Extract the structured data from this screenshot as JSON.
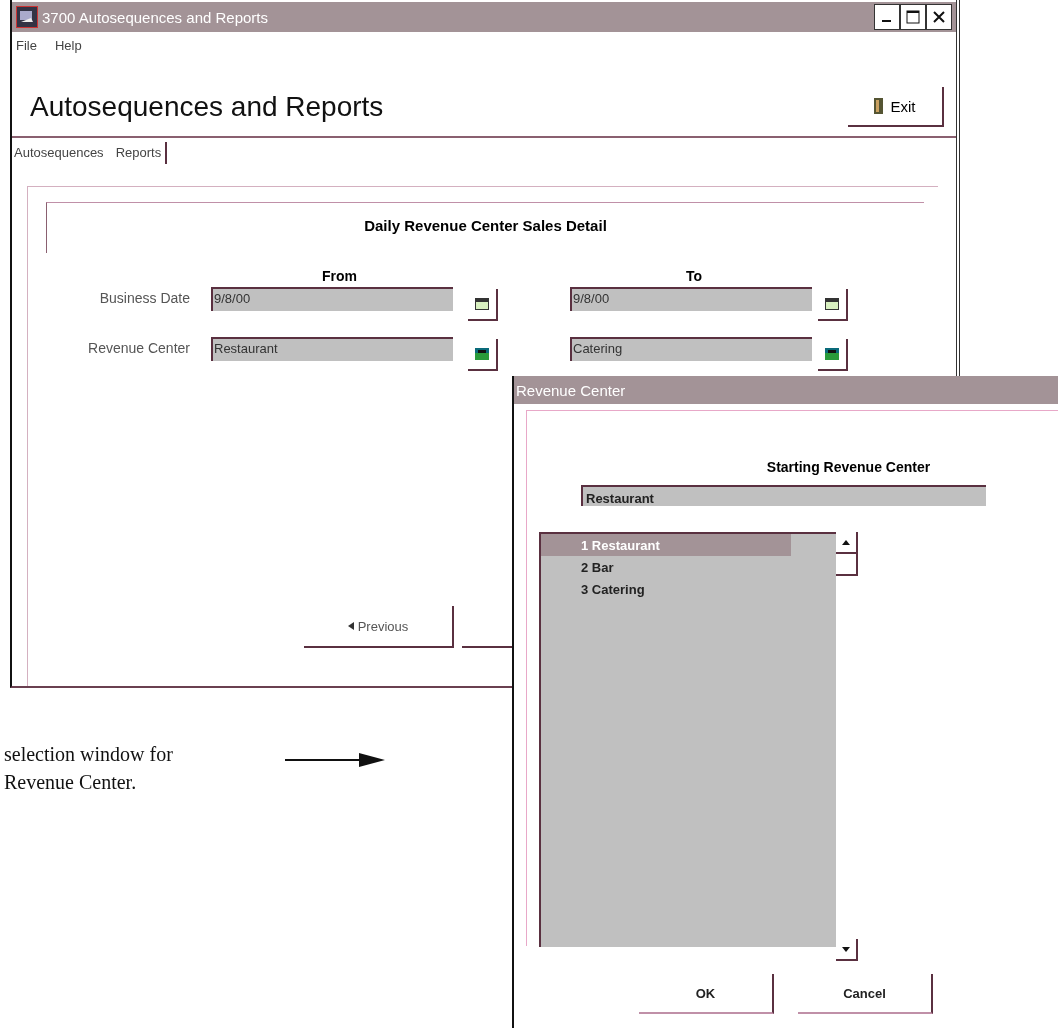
{
  "main_window": {
    "title": "3700 Autosequences and Reports",
    "menu": [
      "File",
      "Help"
    ],
    "heading": "Autosequences and Reports",
    "exit_button": "Exit",
    "tabs": [
      {
        "label": "Autosequences",
        "selected": false
      },
      {
        "label": "Reports",
        "selected": true
      }
    ],
    "report_title": "Daily Revenue Center Sales Detail",
    "columns": [
      "From",
      "To"
    ],
    "rows": [
      {
        "label": "Business Date",
        "kind": "date",
        "from": "9/8/00",
        "to": "9/8/00"
      },
      {
        "label": "Revenue Center",
        "kind": "list",
        "from": "Restaurant",
        "to": "Catering"
      }
    ],
    "previous_button": "Previous"
  },
  "dialog": {
    "title": "Revenue Center",
    "heading": "Starting Revenue Center",
    "value": "Restaurant",
    "items": [
      {
        "label": "1 Restaurant",
        "selected": true
      },
      {
        "label": "2 Bar",
        "selected": false
      },
      {
        "label": "3 Catering",
        "selected": false
      }
    ],
    "buttons": [
      "OK",
      "Cancel"
    ]
  },
  "caption": {
    "lines": [
      "selection window for",
      "Revenue Center."
    ]
  }
}
